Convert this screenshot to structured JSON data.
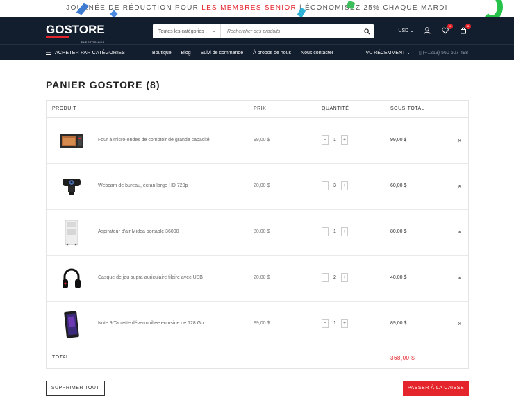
{
  "promo": {
    "part1": "JOURNÉE DE RÉDUCTION POUR ",
    "highlight": "LES MEMBRES SENIOR",
    "part2": " | ÉCONOMISEZ 25% CHAQUE MARDI"
  },
  "header": {
    "logo": "GOSTORE",
    "logo_sub": "ELECTRONICS",
    "search_category": "Toutes les catégories",
    "search_placeholder": "Rechercher des produits",
    "currency": "USD",
    "wishlist_count": "10",
    "cart_count": "8"
  },
  "nav": {
    "browse": "ACHETER PAR CATÉGORIES",
    "links": [
      "Boutique",
      "Blog",
      "Suivi de commande",
      "À propos de nous",
      "Nous contacter"
    ],
    "recent": "VU RÉCEMMENT",
    "phone": "(+1213) 560 607 498"
  },
  "page_title": "PANIER GOSTORE (8)",
  "table": {
    "headers": {
      "product": "PRODUIT",
      "price": "PRIX",
      "quantity": "QUANTITÉ",
      "subtotal": "SOUS-TOTAL"
    },
    "rows": [
      {
        "name": "Four à micro-ondes de comptoir de grande capacité",
        "price": "99,00 $",
        "qty": "1",
        "subtotal": "99,00 $",
        "icon": "microwave-icon"
      },
      {
        "name": "Webcam de bureau, écran large HD 720p",
        "price": "20,00 $",
        "qty": "3",
        "subtotal": "60,00 $",
        "icon": "webcam-icon"
      },
      {
        "name": "Aspirateur d'air Midea portable 36000",
        "price": "80,00 $",
        "qty": "1",
        "subtotal": "80,00 $",
        "icon": "air-conditioner-icon"
      },
      {
        "name": "Casque de jeu supra-auriculaire filaire avec USB",
        "price": "20,00 $",
        "qty": "2",
        "subtotal": "40,00 $",
        "icon": "headphones-icon"
      },
      {
        "name": "Note 9 Tablette déverrouillée en usine de 128 Go",
        "price": "89,00 $",
        "qty": "1",
        "subtotal": "89,00 $",
        "icon": "tablet-icon"
      }
    ],
    "total_label": "TOTAL:",
    "total_value": "368,00 $"
  },
  "actions": {
    "clear": "SUPPRIMER TOUT",
    "checkout": "PASSER À LA CAISSE"
  },
  "colors": {
    "accent": "#e4262c",
    "header_bg": "#121d2e"
  }
}
